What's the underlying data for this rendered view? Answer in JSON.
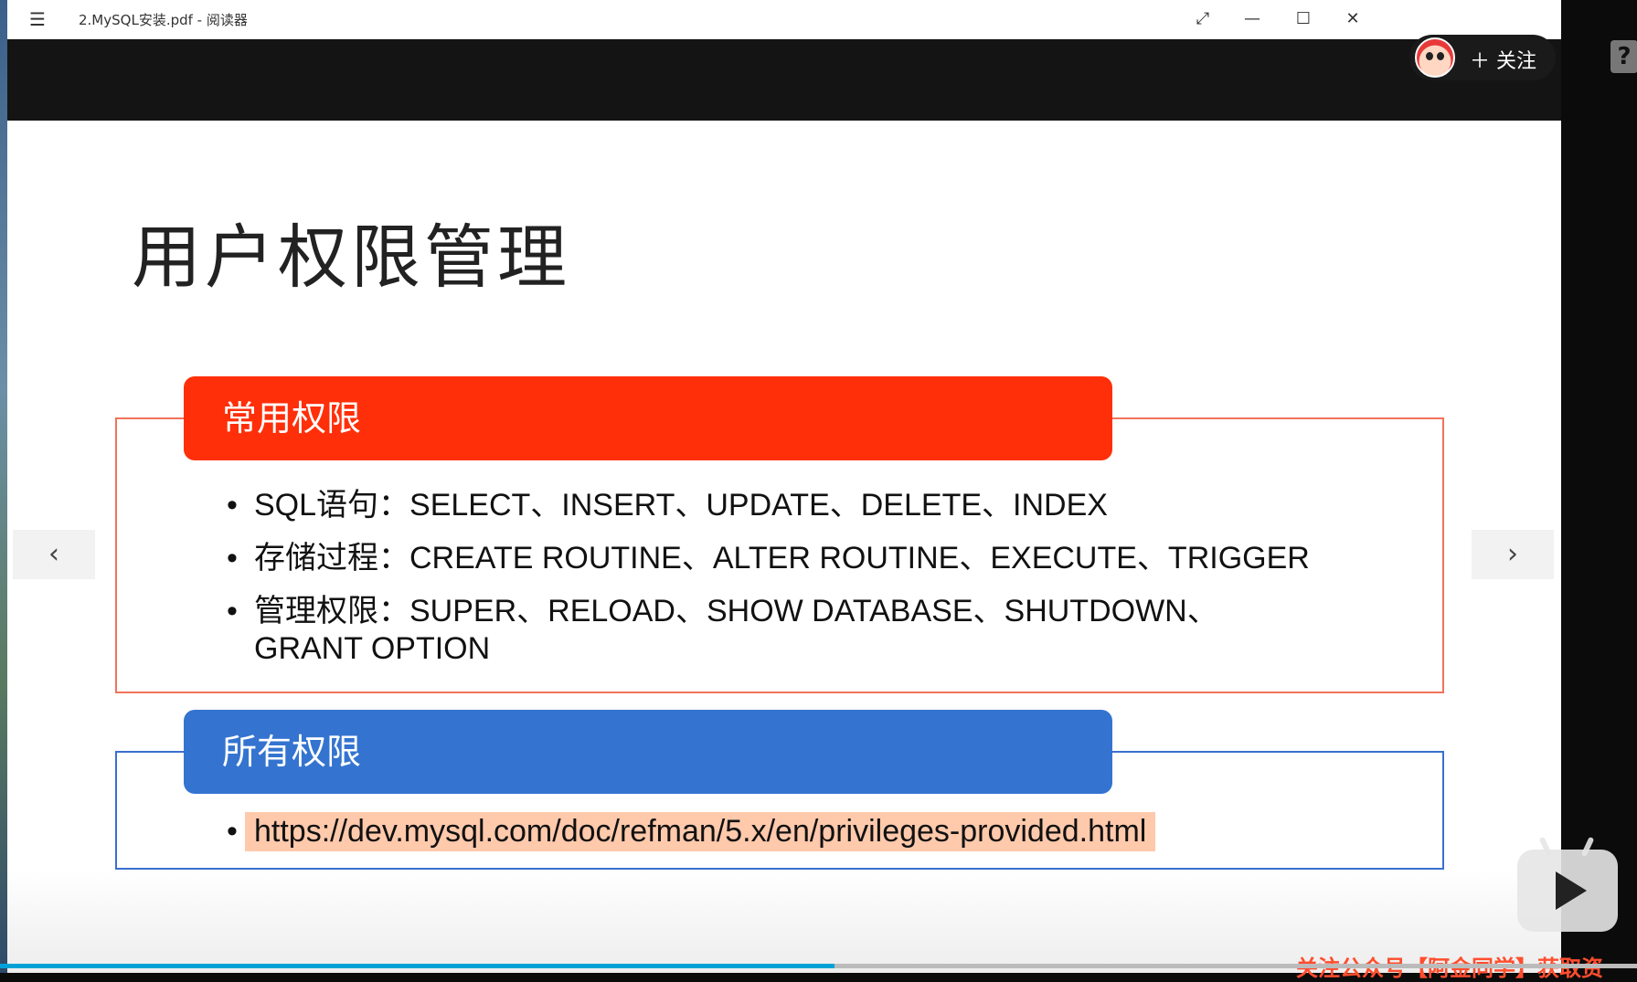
{
  "window": {
    "title": "2.MySQL安装.pdf - 阅读器",
    "menu_icon": "☰",
    "controls": {
      "expand": "⤢",
      "minimize": "—",
      "maximize": "☐",
      "close": "✕"
    }
  },
  "follow": {
    "label": "＋ 关注"
  },
  "slide": {
    "title": "用户权限管理",
    "section1": {
      "heading": "常用权限",
      "items": [
        "SQL语句：SELECT、INSERT、UPDATE、DELETE、INDEX",
        "存储过程：CREATE ROUTINE、ALTER ROUTINE、EXECUTE、TRIGGER",
        "管理权限：SUPER、RELOAD、SHOW DATABASE、SHUTDOWN、"
      ],
      "item3_cont": "GRANT OPTION"
    },
    "section2": {
      "heading": "所有权限",
      "link": "https://dev.mysql.com/doc/refman/5.x/en/privileges-provided.html"
    }
  },
  "nav": {
    "prev": "‹",
    "next": "›"
  },
  "player": {
    "progress": 0.51,
    "watermark": "关注公众号【阿金同学】获取资",
    "help_icon": "?"
  },
  "colors": {
    "red_accent": "#ff2f0a",
    "blue_accent": "#3474d0",
    "link_highlight": "#ffc9ab",
    "progress": "#00a1d6"
  }
}
